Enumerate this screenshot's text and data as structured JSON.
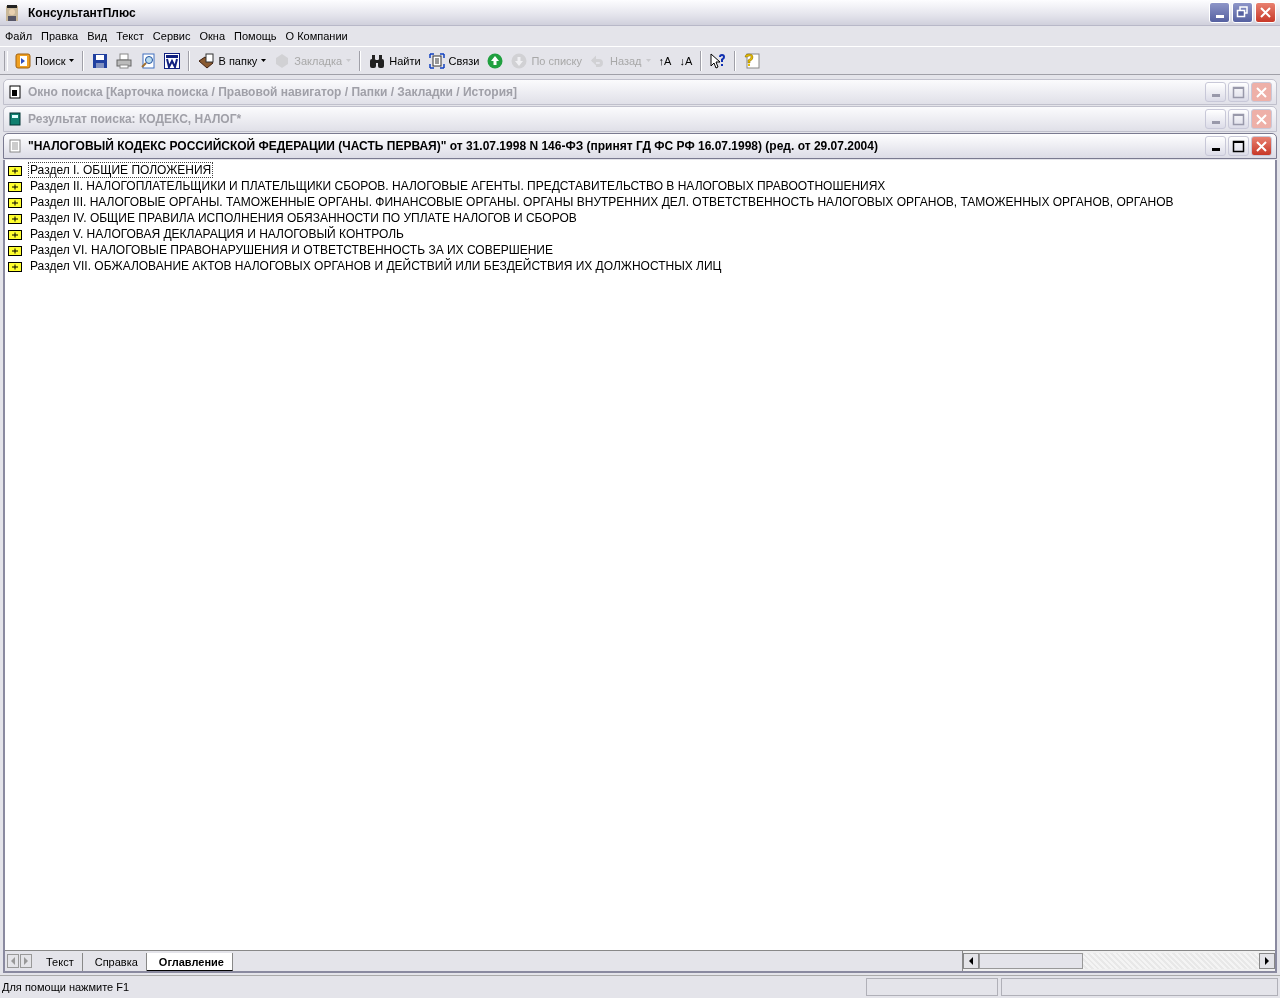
{
  "window": {
    "title": "КонсультантПлюс"
  },
  "menu": [
    {
      "label": "Файл"
    },
    {
      "label": "Правка"
    },
    {
      "label": "Вид"
    },
    {
      "label": "Текст"
    },
    {
      "label": "Сервис"
    },
    {
      "label": "Окна"
    },
    {
      "label": "Помощь"
    },
    {
      "label": "О Компании"
    }
  ],
  "toolbar": [
    {
      "kind": "button",
      "label": "Поиск",
      "dropdown": true,
      "disabled": false
    },
    {
      "kind": "separator"
    },
    {
      "kind": "button",
      "disabled": false
    },
    {
      "kind": "button",
      "disabled": false
    },
    {
      "kind": "button",
      "disabled": false
    },
    {
      "kind": "button",
      "disabled": false
    },
    {
      "kind": "separator"
    },
    {
      "kind": "button",
      "label": "В папку",
      "dropdown": true,
      "disabled": false
    },
    {
      "kind": "button",
      "label": "Закладка",
      "dropdown": true,
      "disabled": true
    },
    {
      "kind": "separator"
    },
    {
      "kind": "button",
      "label": "Найти",
      "disabled": false
    },
    {
      "kind": "button",
      "label": "Связи",
      "disabled": false
    },
    {
      "kind": "button",
      "disabled": false
    },
    {
      "kind": "button",
      "label": "По списку",
      "disabled": true
    },
    {
      "kind": "button",
      "label": "Назад",
      "dropdown": true,
      "disabled": true
    },
    {
      "kind": "button",
      "label": "↑A",
      "disabled": false
    },
    {
      "kind": "button",
      "label": "↓A",
      "disabled": false
    },
    {
      "kind": "separator"
    },
    {
      "kind": "button",
      "disabled": false
    },
    {
      "kind": "separator"
    },
    {
      "kind": "button",
      "disabled": false
    }
  ],
  "child_windows": [
    {
      "title": "Окно поиска [Карточка поиска / Правовой навигатор / Папки / Закладки / История]",
      "active": false
    },
    {
      "title": "Результат поиска: КОДЕКС, НАЛОГ*",
      "active": false
    },
    {
      "title": "\"НАЛОГОВЫЙ КОДЕКС РОССИЙСКОЙ ФЕДЕРАЦИИ (ЧАСТЬ ПЕРВАЯ)\" от 31.07.1998 N 146-ФЗ (принят ГД ФС РФ 16.07.1998) (ред. от 29.07.2004)",
      "active": true
    }
  ],
  "contents": [
    {
      "text": "Раздел I. ОБЩИЕ ПОЛОЖЕНИЯ",
      "expanded": false,
      "selected": true
    },
    {
      "text": "Раздел II. НАЛОГОПЛАТЕЛЬЩИКИ И ПЛАТЕЛЬЩИКИ СБОРОВ. НАЛОГОВЫЕ АГЕНТЫ. ПРЕДСТАВИТЕЛЬСТВО В НАЛОГОВЫХ ПРАВООТНОШЕНИЯХ",
      "expanded": false,
      "selected": false
    },
    {
      "text": "Раздел III. НАЛОГОВЫЕ ОРГАНЫ. ТАМОЖЕННЫЕ ОРГАНЫ. ФИНАНСОВЫЕ ОРГАНЫ. ОРГАНЫ ВНУТРЕННИХ ДЕЛ. ОТВЕТСТВЕННОСТЬ НАЛОГОВЫХ ОРГАНОВ, ТАМОЖЕННЫХ ОРГАНОВ, ОРГАНОВ",
      "expanded": false,
      "selected": false
    },
    {
      "text": "Раздел IV. ОБЩИЕ ПРАВИЛА ИСПОЛНЕНИЯ ОБЯЗАННОСТИ ПО УПЛАТЕ НАЛОГОВ И СБОРОВ",
      "expanded": false,
      "selected": false
    },
    {
      "text": "Раздел V. НАЛОГОВАЯ ДЕКЛАРАЦИЯ И НАЛОГОВЫЙ КОНТРОЛЬ",
      "expanded": false,
      "selected": false
    },
    {
      "text": "Раздел VI. НАЛОГОВЫЕ ПРАВОНАРУШЕНИЯ И ОТВЕТСТВЕННОСТЬ ЗА ИХ СОВЕРШЕНИЕ",
      "expanded": false,
      "selected": false
    },
    {
      "text": "Раздел VII. ОБЖАЛОВАНИЕ АКТОВ НАЛОГОВЫХ ОРГАНОВ И ДЕЙСТВИЙ ИЛИ БЕЗДЕЙСТВИЯ ИХ ДОЛЖНОСТНЫХ ЛИЦ",
      "expanded": false,
      "selected": false
    }
  ],
  "view_tabs": [
    {
      "label": "Текст",
      "selected": false
    },
    {
      "label": "Справка",
      "selected": false
    },
    {
      "label": "Оглавление",
      "selected": true
    }
  ],
  "status_bar": {
    "text": "Для помощи нажмите F1"
  }
}
